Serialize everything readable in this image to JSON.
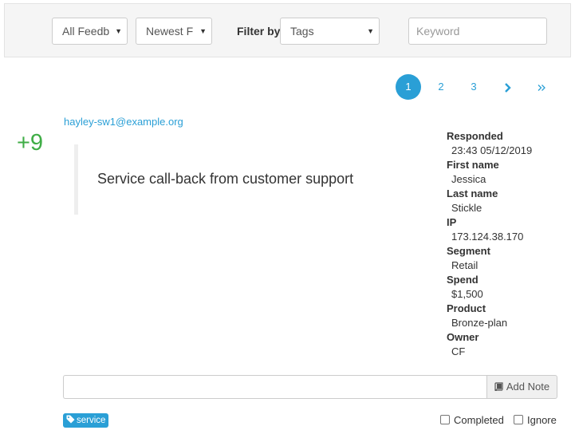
{
  "filters": {
    "feedback_select": "All Feedb",
    "sort_select": "Newest F",
    "filter_by_label": "Filter by",
    "tags_select": "Tags",
    "keyword_placeholder": "Keyword",
    "keyword_value": ""
  },
  "pagination": {
    "pages": [
      "1",
      "2",
      "3"
    ],
    "active_page": "1",
    "next_icon": "chevron-right-icon",
    "last_icon": "double-chevron-right-icon"
  },
  "response": {
    "email": "hayley-sw1@example.org",
    "score": "+9",
    "comment": "Service call-back from customer support",
    "score_color": "#3fad46"
  },
  "details": [
    {
      "label": "Responded",
      "value": "23:43 05/12/2019"
    },
    {
      "label": "First name",
      "value": "Jessica"
    },
    {
      "label": "Last name",
      "value": "Stickle"
    },
    {
      "label": "IP",
      "value": "173.124.38.170"
    },
    {
      "label": "Segment",
      "value": "Retail"
    },
    {
      "label": "Spend",
      "value": "$1,500"
    },
    {
      "label": "Product",
      "value": "Bronze-plan"
    },
    {
      "label": "Owner",
      "value": "CF"
    }
  ],
  "note": {
    "input_value": "",
    "button_label": "Add Note",
    "button_icon": "book-icon"
  },
  "tags": [
    {
      "label": "service",
      "icon": "tag-icon"
    }
  ],
  "checkboxes": {
    "completed_label": "Completed",
    "ignore_label": "Ignore"
  },
  "colors": {
    "accent": "#2a9fd6",
    "score": "#3fad46"
  }
}
